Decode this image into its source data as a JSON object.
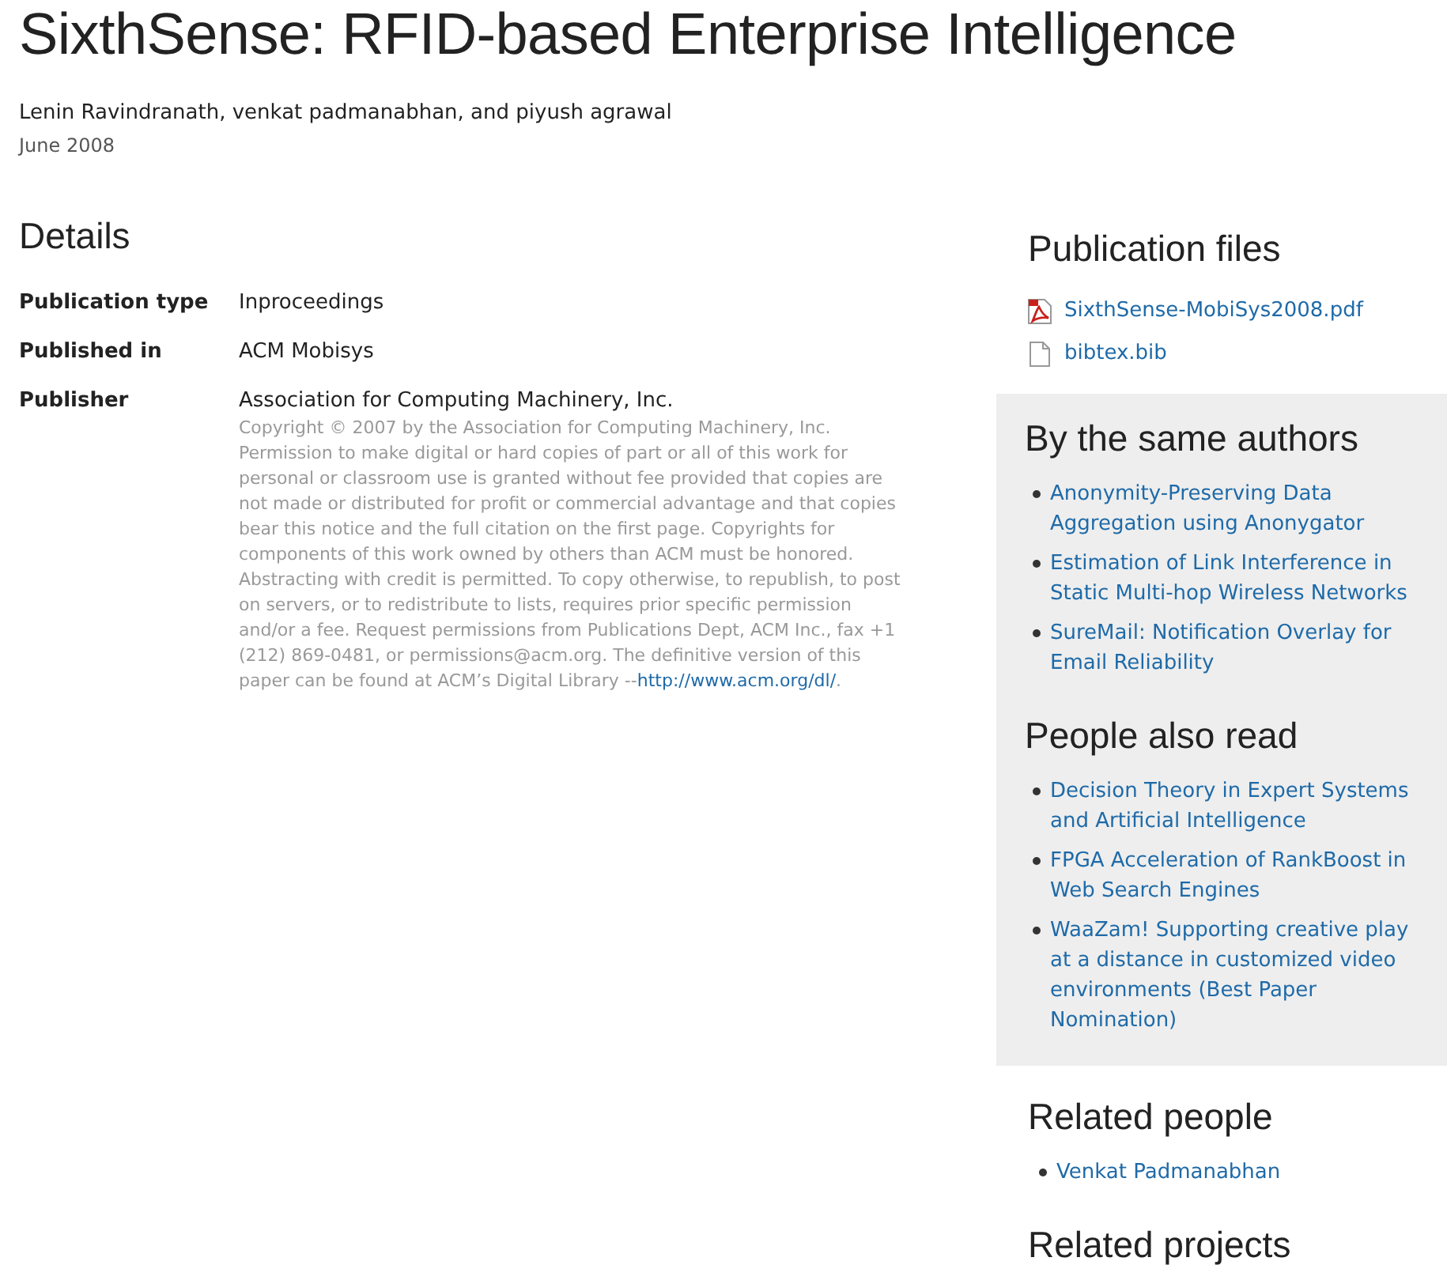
{
  "title": "SixthSense: RFID-based Enterprise Intelligence",
  "authors": "Lenin Ravindranath, venkat padmanabhan, and piyush agrawal",
  "date": "June 2008",
  "details": {
    "heading": "Details",
    "rows": [
      {
        "label": "Publication type",
        "value": "Inproceedings"
      },
      {
        "label": "Published in",
        "value": "ACM Mobisys"
      },
      {
        "label": "Publisher",
        "value": "Association for Computing Machinery, Inc.",
        "note": {
          "text": "Copyright © 2007 by the Association for Computing Machinery, Inc. Permission to make digital or hard copies of part or all of this work for personal or classroom use is granted without fee provided that copies are not made or distributed for profit or commercial advantage and that copies bear this notice and the full citation on the first page. Copyrights for components of this work owned by others than ACM must be honored. Abstracting with credit is permitted. To copy otherwise, to republish, to post on servers, or to redistribute to lists, requires prior specific permission and/or a fee. Request permissions from Publications Dept, ACM Inc., fax +1 (212) 869-0481, or permissions@acm.org. The definitive version of this paper can be found at ACM’s Digital Library --",
          "link": "http://www.acm.org/dl/",
          "after": "."
        }
      }
    ]
  },
  "publication_files": {
    "heading": "Publication files",
    "files": [
      {
        "kind": "pdf",
        "name": "SixthSense-MobiSys2008.pdf"
      },
      {
        "kind": "document",
        "name": "bibtex.bib"
      }
    ]
  },
  "same_authors": {
    "heading": "By the same authors",
    "items": [
      "Anonymity-Preserving Data Aggregation using Anonygator",
      "Estimation of Link Interference in Static Multi-hop Wireless Networks",
      "SureMail: Notification Overlay for Email Reliability"
    ]
  },
  "people_also_read": {
    "heading": "People also read",
    "items": [
      "Decision Theory in Expert Systems and Artificial Intelligence",
      "FPGA Acceleration of RankBoost in Web Search Engines",
      "WaaZam! Supporting creative play at a distance in customized video environments (Best Paper Nomination)"
    ]
  },
  "related_people": {
    "heading": "Related people",
    "items": [
      "Venkat Padmanabhan"
    ]
  },
  "related_projects": {
    "heading": "Related projects"
  }
}
